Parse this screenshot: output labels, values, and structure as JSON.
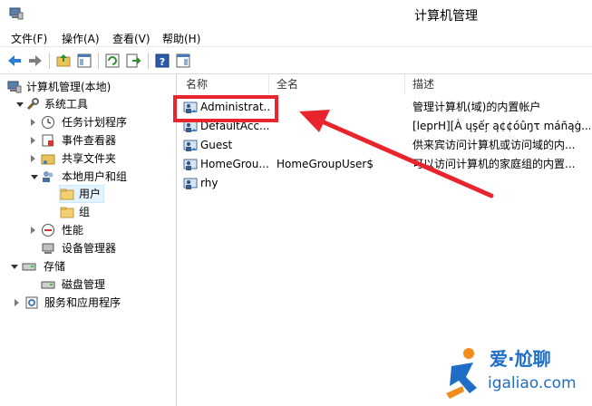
{
  "window": {
    "title": "计算机管理"
  },
  "menu": [
    "文件(F)",
    "操作(A)",
    "查看(V)",
    "帮助(H)"
  ],
  "tree": {
    "root": "计算机管理(本地)",
    "items": [
      {
        "label": "系统工具"
      },
      {
        "label": "任务计划程序"
      },
      {
        "label": "事件查看器"
      },
      {
        "label": "共享文件夹"
      },
      {
        "label": "本地用户和组"
      },
      {
        "label": "用户"
      },
      {
        "label": "组"
      },
      {
        "label": "性能"
      },
      {
        "label": "设备管理器"
      },
      {
        "label": "存储"
      },
      {
        "label": "磁盘管理"
      },
      {
        "label": "服务和应用程序"
      }
    ]
  },
  "list": {
    "columns": [
      "名称",
      "全名",
      "描述"
    ],
    "rows": [
      {
        "name": "Administrat...",
        "fullname": "",
        "desc": "管理计算机(域)的内置帐户"
      },
      {
        "name": "DefaultAcc...",
        "fullname": "",
        "desc": "[leprH][À ųşếŗ ą¢¢óûŋτ máñąġ..."
      },
      {
        "name": "Guest",
        "fullname": "",
        "desc": "供来宾访问计算机或访问域的内..."
      },
      {
        "name": "HomeGrou...",
        "fullname": "HomeGroupUser$",
        "desc": "可以访问计算机的家庭组的内置..."
      },
      {
        "name": "rhy",
        "fullname": "",
        "desc": ""
      }
    ]
  },
  "watermark": {
    "brand": "爱·尬聊",
    "site": "igaliao.com"
  },
  "colors": {
    "highlight": "#e8252d",
    "selection": "#e5f3ff",
    "watermark": "#1f6ec6"
  }
}
